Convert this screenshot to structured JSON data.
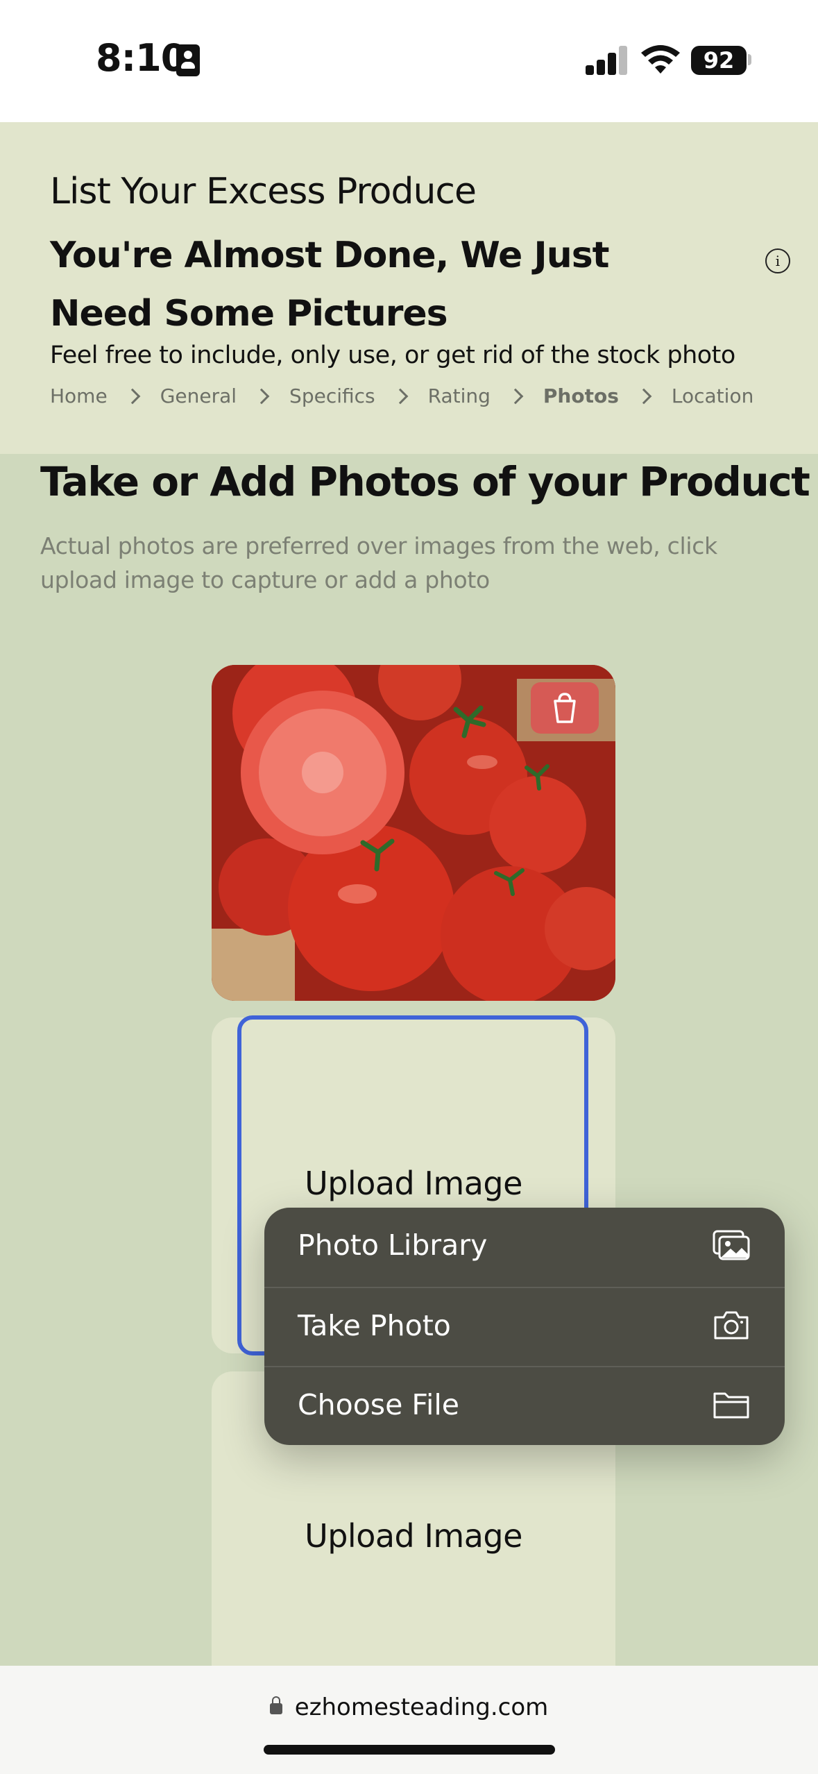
{
  "status_bar": {
    "time": "8:10",
    "battery": "92"
  },
  "header": {
    "title": "List Your Excess Produce",
    "subtitle": "You're Almost Done, We Just Need Some Pictures",
    "description": "Feel free to include, only use, or get rid of the stock photo",
    "breadcrumbs": [
      {
        "label": "Home",
        "active": false
      },
      {
        "label": "General",
        "active": false
      },
      {
        "label": "Specifics",
        "active": false
      },
      {
        "label": "Rating",
        "active": false
      },
      {
        "label": "Photos",
        "active": true
      },
      {
        "label": "Location",
        "active": false
      }
    ]
  },
  "main": {
    "title": "Take or Add Photos of your Product",
    "description": "Actual photos are preferred over images from the web, click upload image to capture or add a photo",
    "upload_label_1": "Upload Image",
    "upload_label_2": "Upload Image"
  },
  "context_menu": {
    "items": [
      {
        "label": "Photo Library",
        "icon": "photo-library-icon"
      },
      {
        "label": "Take Photo",
        "icon": "camera-icon"
      },
      {
        "label": "Choose File",
        "icon": "folder-icon"
      }
    ]
  },
  "browser": {
    "url": "ezhomesteading.com"
  },
  "colors": {
    "header_bg": "#e1e5cc",
    "page_bg": "#cfd9bd",
    "menu_bg": "#4c4c44",
    "focus": "#3f63d8",
    "trash": "#d65a55"
  }
}
